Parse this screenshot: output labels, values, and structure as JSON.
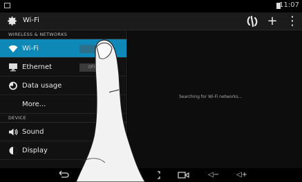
{
  "status": {
    "time": "11:07",
    "icons": [
      "notification-icon",
      "battery-icon"
    ]
  },
  "actionbar": {
    "title": "Wi-Fi",
    "icons": [
      "gear-icon",
      "wps-icon",
      "add-icon",
      "overflow-menu-icon"
    ],
    "add_glyph": "+",
    "overflow_glyph": "⋮"
  },
  "sections": {
    "wireless": "WIRELESS & NETWORKS",
    "device": "DEVICE"
  },
  "items": {
    "wifi": {
      "label": "Wi-Fi",
      "icon": "wifi-icon",
      "toggle": ""
    },
    "ethernet": {
      "label": "Ethernet",
      "icon": "ethernet-icon",
      "toggle": "OFF"
    },
    "data_usage": {
      "label": "Data usage",
      "icon": "data-usage-icon"
    },
    "more": {
      "label": "More..."
    },
    "sound": {
      "label": "Sound",
      "icon": "sound-icon"
    },
    "display": {
      "label": "Display",
      "icon": "display-icon"
    }
  },
  "main": {
    "searching": "Searching for Wi-Fi networks..."
  },
  "navbar": {
    "icons": [
      "back-icon",
      "home-icon",
      "recents-icon",
      "screenshot-icon",
      "camera-icon",
      "volume-down-icon",
      "volume-up-icon"
    ],
    "vol_down": "◁−",
    "vol_up": "◁+"
  },
  "colors": {
    "accent": "#0e88b6",
    "background": "#111111"
  }
}
